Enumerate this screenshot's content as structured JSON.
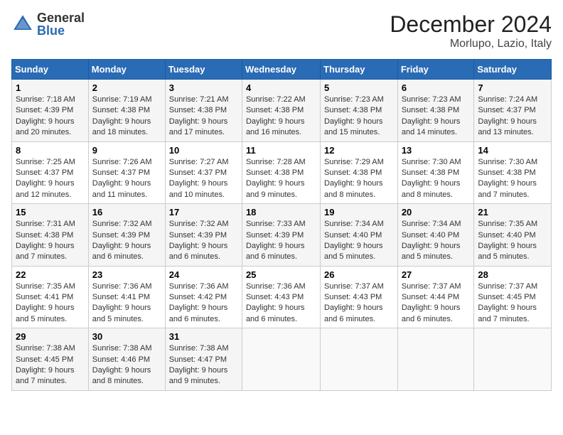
{
  "header": {
    "logo_general": "General",
    "logo_blue": "Blue",
    "title": "December 2024",
    "subtitle": "Morlupo, Lazio, Italy"
  },
  "days_of_week": [
    "Sunday",
    "Monday",
    "Tuesday",
    "Wednesday",
    "Thursday",
    "Friday",
    "Saturday"
  ],
  "weeks": [
    [
      {
        "day": "1",
        "info": "Sunrise: 7:18 AM\nSunset: 4:39 PM\nDaylight: 9 hours and 20 minutes."
      },
      {
        "day": "2",
        "info": "Sunrise: 7:19 AM\nSunset: 4:38 PM\nDaylight: 9 hours and 18 minutes."
      },
      {
        "day": "3",
        "info": "Sunrise: 7:21 AM\nSunset: 4:38 PM\nDaylight: 9 hours and 17 minutes."
      },
      {
        "day": "4",
        "info": "Sunrise: 7:22 AM\nSunset: 4:38 PM\nDaylight: 9 hours and 16 minutes."
      },
      {
        "day": "5",
        "info": "Sunrise: 7:23 AM\nSunset: 4:38 PM\nDaylight: 9 hours and 15 minutes."
      },
      {
        "day": "6",
        "info": "Sunrise: 7:23 AM\nSunset: 4:38 PM\nDaylight: 9 hours and 14 minutes."
      },
      {
        "day": "7",
        "info": "Sunrise: 7:24 AM\nSunset: 4:37 PM\nDaylight: 9 hours and 13 minutes."
      }
    ],
    [
      {
        "day": "8",
        "info": "Sunrise: 7:25 AM\nSunset: 4:37 PM\nDaylight: 9 hours and 12 minutes."
      },
      {
        "day": "9",
        "info": "Sunrise: 7:26 AM\nSunset: 4:37 PM\nDaylight: 9 hours and 11 minutes."
      },
      {
        "day": "10",
        "info": "Sunrise: 7:27 AM\nSunset: 4:37 PM\nDaylight: 9 hours and 10 minutes."
      },
      {
        "day": "11",
        "info": "Sunrise: 7:28 AM\nSunset: 4:38 PM\nDaylight: 9 hours and 9 minutes."
      },
      {
        "day": "12",
        "info": "Sunrise: 7:29 AM\nSunset: 4:38 PM\nDaylight: 9 hours and 8 minutes."
      },
      {
        "day": "13",
        "info": "Sunrise: 7:30 AM\nSunset: 4:38 PM\nDaylight: 9 hours and 8 minutes."
      },
      {
        "day": "14",
        "info": "Sunrise: 7:30 AM\nSunset: 4:38 PM\nDaylight: 9 hours and 7 minutes."
      }
    ],
    [
      {
        "day": "15",
        "info": "Sunrise: 7:31 AM\nSunset: 4:38 PM\nDaylight: 9 hours and 7 minutes."
      },
      {
        "day": "16",
        "info": "Sunrise: 7:32 AM\nSunset: 4:39 PM\nDaylight: 9 hours and 6 minutes."
      },
      {
        "day": "17",
        "info": "Sunrise: 7:32 AM\nSunset: 4:39 PM\nDaylight: 9 hours and 6 minutes."
      },
      {
        "day": "18",
        "info": "Sunrise: 7:33 AM\nSunset: 4:39 PM\nDaylight: 9 hours and 6 minutes."
      },
      {
        "day": "19",
        "info": "Sunrise: 7:34 AM\nSunset: 4:40 PM\nDaylight: 9 hours and 5 minutes."
      },
      {
        "day": "20",
        "info": "Sunrise: 7:34 AM\nSunset: 4:40 PM\nDaylight: 9 hours and 5 minutes."
      },
      {
        "day": "21",
        "info": "Sunrise: 7:35 AM\nSunset: 4:40 PM\nDaylight: 9 hours and 5 minutes."
      }
    ],
    [
      {
        "day": "22",
        "info": "Sunrise: 7:35 AM\nSunset: 4:41 PM\nDaylight: 9 hours and 5 minutes."
      },
      {
        "day": "23",
        "info": "Sunrise: 7:36 AM\nSunset: 4:41 PM\nDaylight: 9 hours and 5 minutes."
      },
      {
        "day": "24",
        "info": "Sunrise: 7:36 AM\nSunset: 4:42 PM\nDaylight: 9 hours and 6 minutes."
      },
      {
        "day": "25",
        "info": "Sunrise: 7:36 AM\nSunset: 4:43 PM\nDaylight: 9 hours and 6 minutes."
      },
      {
        "day": "26",
        "info": "Sunrise: 7:37 AM\nSunset: 4:43 PM\nDaylight: 9 hours and 6 minutes."
      },
      {
        "day": "27",
        "info": "Sunrise: 7:37 AM\nSunset: 4:44 PM\nDaylight: 9 hours and 6 minutes."
      },
      {
        "day": "28",
        "info": "Sunrise: 7:37 AM\nSunset: 4:45 PM\nDaylight: 9 hours and 7 minutes."
      }
    ],
    [
      {
        "day": "29",
        "info": "Sunrise: 7:38 AM\nSunset: 4:45 PM\nDaylight: 9 hours and 7 minutes."
      },
      {
        "day": "30",
        "info": "Sunrise: 7:38 AM\nSunset: 4:46 PM\nDaylight: 9 hours and 8 minutes."
      },
      {
        "day": "31",
        "info": "Sunrise: 7:38 AM\nSunset: 4:47 PM\nDaylight: 9 hours and 9 minutes."
      },
      null,
      null,
      null,
      null
    ]
  ]
}
